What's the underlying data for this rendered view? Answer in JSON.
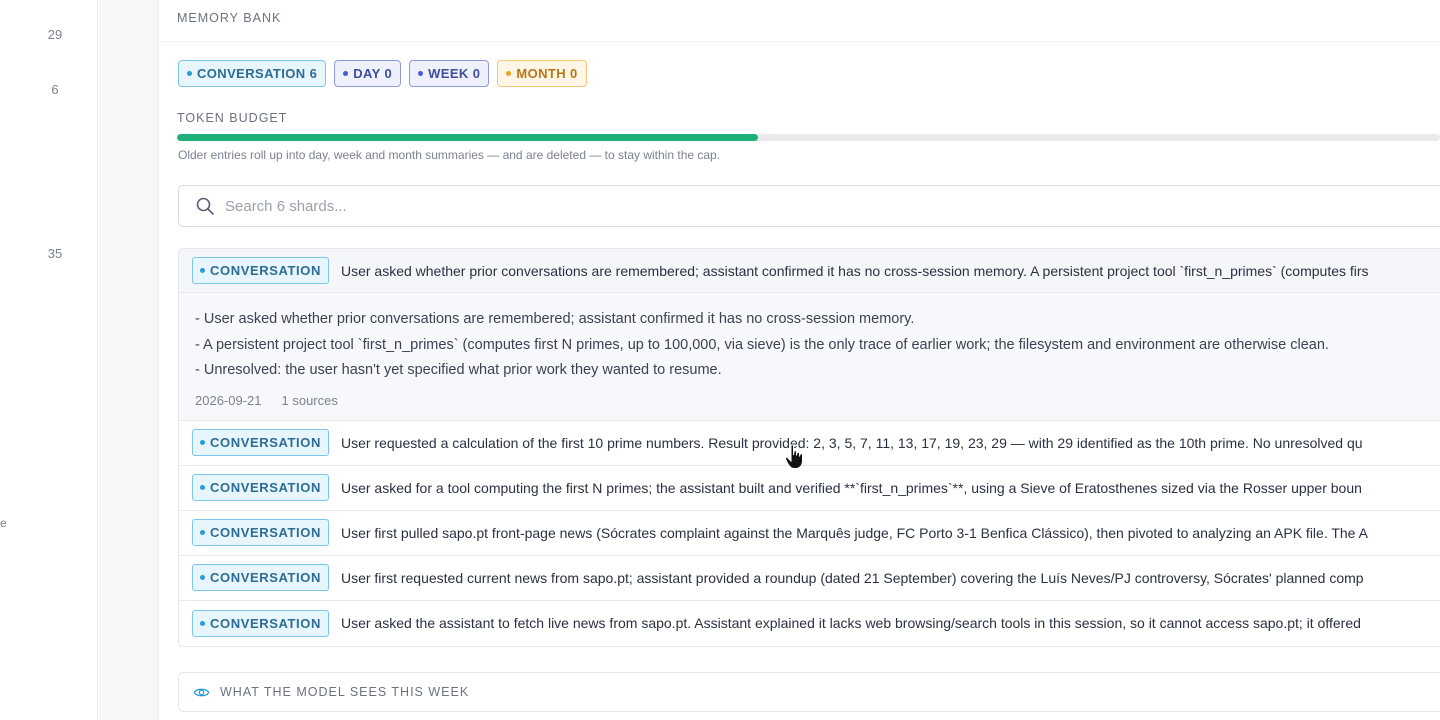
{
  "gutter": {
    "numbers": [
      "29",
      "6",
      "35"
    ],
    "fragment": "e"
  },
  "panel": {
    "title": "MEMORY BANK",
    "chips": [
      {
        "label": "CONVERSATION 6"
      },
      {
        "label": "DAY 0"
      },
      {
        "label": "WEEK 0"
      },
      {
        "label": "MONTH 0"
      }
    ],
    "token_budget": {
      "label": "TOKEN BUDGET",
      "fill_fraction": 0.46,
      "fill_color": "#1fb07a",
      "note": "Older entries roll up into day, week and month summaries — and are deleted — to stay within the cap."
    },
    "search": {
      "placeholder": "Search 6 shards..."
    },
    "entries": [
      {
        "tag": "CONVERSATION",
        "text": "User asked whether prior conversations are remembered; assistant confirmed it has no cross-session memory. A persistent project tool `first_n_primes` (computes firs",
        "expanded": {
          "lines": [
            "- User asked whether prior conversations are remembered; assistant confirmed it has no cross-session memory.",
            "- A persistent project tool `first_n_primes` (computes first N primes, up to 100,000, via sieve) is the only trace of earlier work; the filesystem and environment are otherwise clean.",
            "- Unresolved: the user hasn't yet specified what prior work they wanted to resume."
          ],
          "date": "2026-09-21",
          "sources": "1 sources"
        }
      },
      {
        "tag": "CONVERSATION",
        "text": "User requested a calculation of the first 10 prime numbers. Result provided: 2, 3, 5, 7, 11, 13, 17, 19, 23, 29 — with 29 identified as the 10th prime. No unresolved qu"
      },
      {
        "tag": "CONVERSATION",
        "text": "User asked for a tool computing the first N primes; the assistant built and verified **`first_n_primes`**, using a Sieve of Eratosthenes sized via the Rosser upper boun"
      },
      {
        "tag": "CONVERSATION",
        "text": "User first pulled sapo.pt front-page news (Sócrates complaint against the Marquês judge, FC Porto 3-1 Benfica Clássico), then pivoted to analyzing an APK file. The A"
      },
      {
        "tag": "CONVERSATION",
        "text": "User first requested current news from sapo.pt; assistant provided a roundup (dated 21 September) covering the Luís Neves/PJ controversy, Sócrates' planned comp"
      },
      {
        "tag": "CONVERSATION",
        "text": "User asked the assistant to fetch live news from sapo.pt. Assistant explained it lacks web browsing/search tools in this session, so it cannot access sapo.pt; it offered"
      }
    ],
    "model_sees": {
      "label": "WHAT THE MODEL SEES THIS WEEK",
      "icon": "eye-icon"
    }
  }
}
